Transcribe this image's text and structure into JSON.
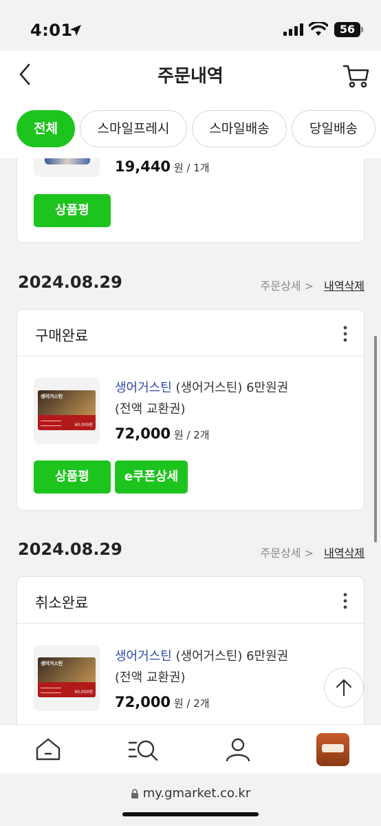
{
  "status_bar": {
    "time": "4:01",
    "battery": "56"
  },
  "header": {
    "title": "주문내역"
  },
  "tabs": [
    {
      "label": "전체",
      "active": true
    },
    {
      "label": "스마일프레시",
      "active": false
    },
    {
      "label": "스마일배송",
      "active": false
    },
    {
      "label": "당일배송",
      "active": false
    }
  ],
  "partial_order": {
    "price": "19,440",
    "unit_qty": "원 / 1개",
    "review_button": "상품평"
  },
  "orders": [
    {
      "date": "2024.08.29",
      "detail_link": "주문상세 >",
      "delete_link": "내역삭제",
      "status": "구매완료",
      "brand": "생어거스틴",
      "name_rest": " (생어거스틴) 6만원권",
      "name_line2": "(전액 교환권)",
      "price": "72,000",
      "unit_qty": "원 / 2개",
      "buttons": [
        "상품평",
        "e쿠폰상세"
      ],
      "coupon": {
        "brand": "생어거스틴",
        "amount": "60,000원"
      }
    },
    {
      "date": "2024.08.29",
      "detail_link": "주문상세 >",
      "delete_link": "내역삭제",
      "status": "취소완료",
      "brand": "생어거스틴",
      "name_rest": " (생어거스틴) 6만원권",
      "name_line2": "(전액 교환권)",
      "price": "72,000",
      "unit_qty": "원 / 2개",
      "coupon": {
        "brand": "생어거스틴",
        "amount": "60,000원"
      }
    }
  ],
  "bottom_nav": [
    {
      "icon": "home-icon"
    },
    {
      "icon": "category-search-icon"
    },
    {
      "icon": "my-page-icon"
    },
    {
      "icon": "recent-item-thumbnail"
    }
  ],
  "browser": {
    "url": "my.gmarket.co.kr"
  },
  "colors": {
    "accent": "#1ec41e",
    "brand_link": "#2e4aa8"
  }
}
